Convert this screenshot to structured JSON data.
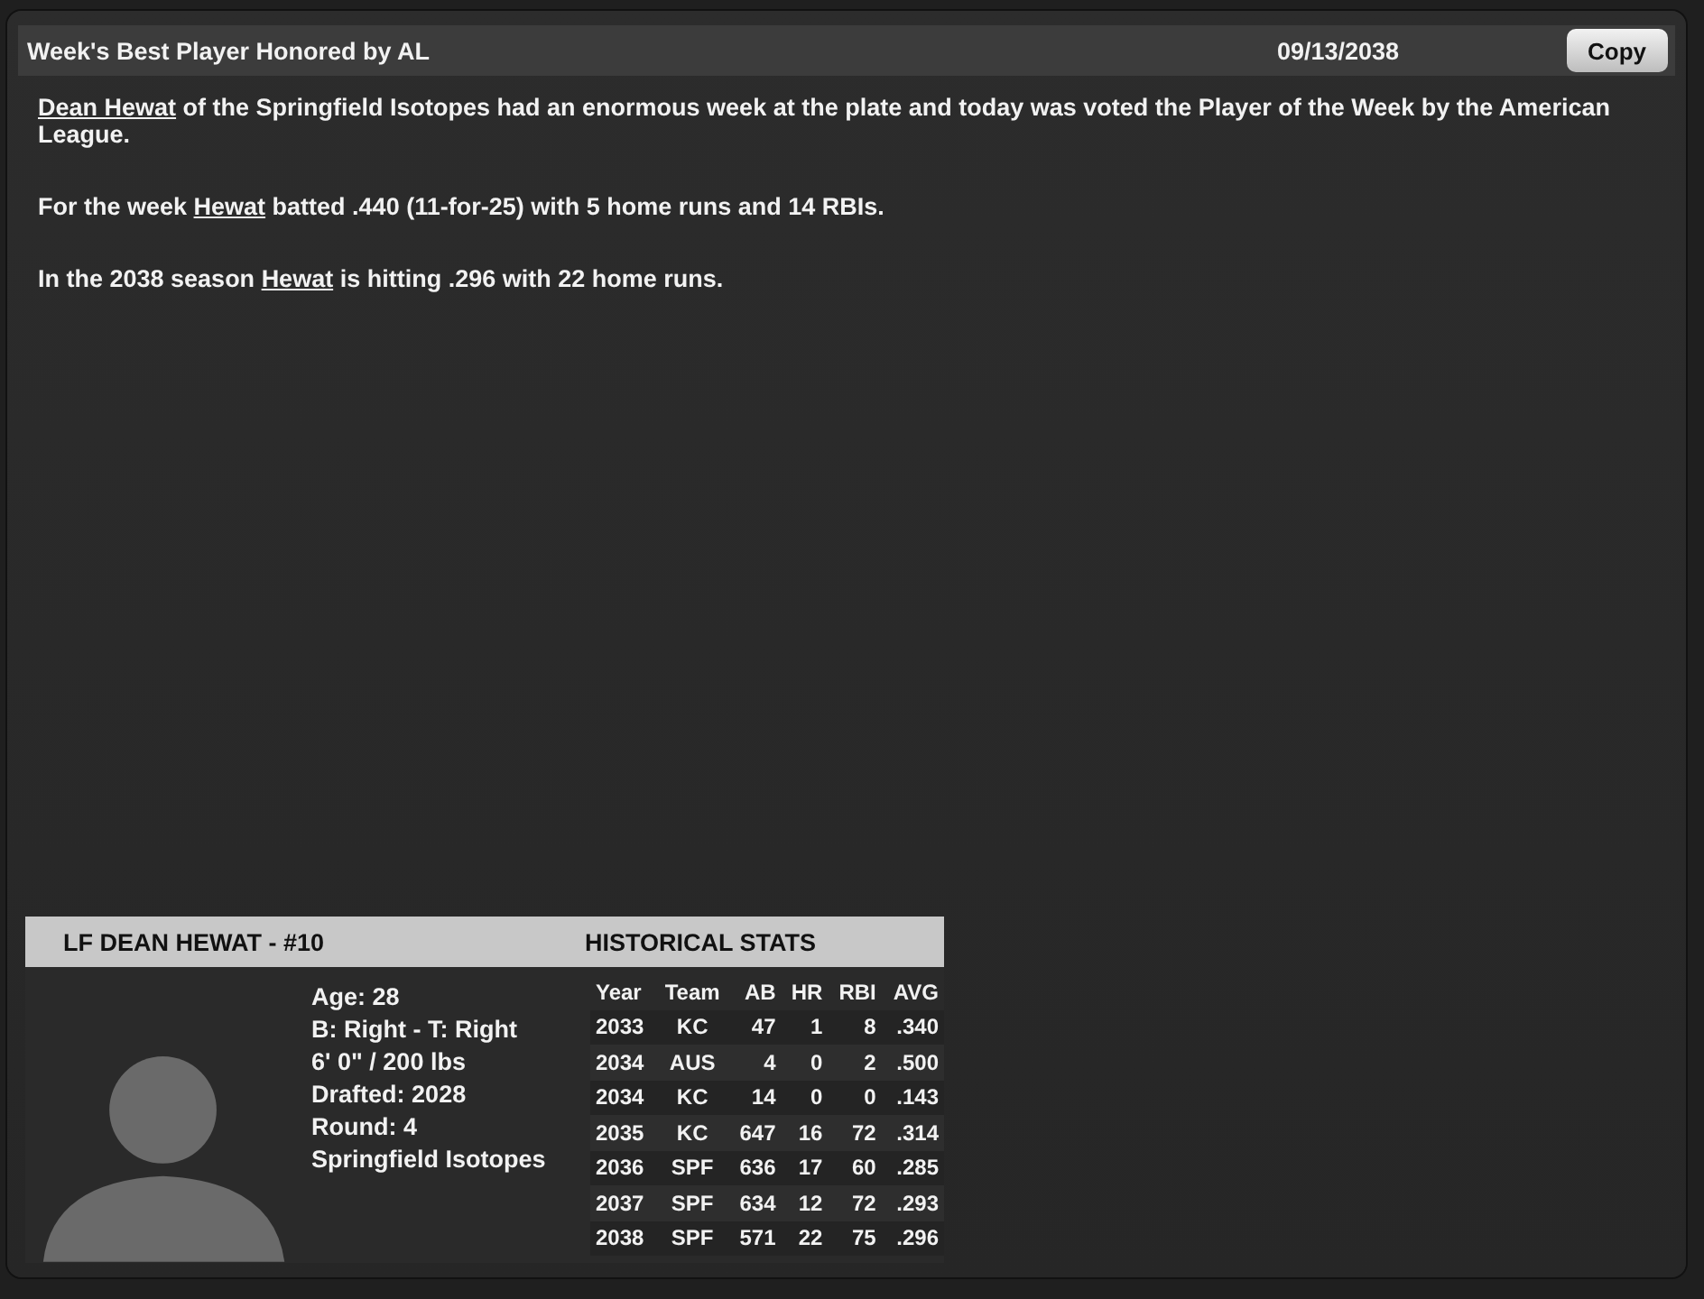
{
  "header": {
    "title": "Week's Best Player Honored by AL",
    "date": "09/13/2038",
    "button": "Copy"
  },
  "paragraphs": [
    {
      "link": "Dean Hewat",
      "after": " of the Springfield Isotopes had an enormous week at the plate and today was voted the Player of the Week by the American League."
    },
    {
      "before": "For the week ",
      "link": "Hewat",
      "after": " batted .440 (11-for-25) with 5 home runs and 14 RBIs."
    },
    {
      "before": "In the 2038 season ",
      "link": "Hewat",
      "after": " is hitting .296 with 22 home runs."
    }
  ],
  "player_card": {
    "title": "LF DEAN HEWAT - #10",
    "stats_title": "HISTORICAL STATS",
    "details": [
      "Age: 28",
      "B: Right - T: Right",
      "6' 0\" / 200 lbs",
      "Drafted: 2028",
      "Round: 4",
      "Springfield Isotopes"
    ],
    "stats": {
      "columns": [
        "Year",
        "Team",
        "AB",
        "HR",
        "RBI",
        "AVG"
      ],
      "rows": [
        [
          "2033",
          "KC",
          "47",
          "1",
          "8",
          ".340"
        ],
        [
          "2034",
          "AUS",
          "4",
          "0",
          "2",
          ".500"
        ],
        [
          "2034",
          "KC",
          "14",
          "0",
          "0",
          ".143"
        ],
        [
          "2035",
          "KC",
          "647",
          "16",
          "72",
          ".314"
        ],
        [
          "2036",
          "SPF",
          "636",
          "17",
          "60",
          ".285"
        ],
        [
          "2037",
          "SPF",
          "634",
          "12",
          "72",
          ".293"
        ],
        [
          "2038",
          "SPF",
          "571",
          "22",
          "75",
          ".296"
        ]
      ]
    }
  }
}
